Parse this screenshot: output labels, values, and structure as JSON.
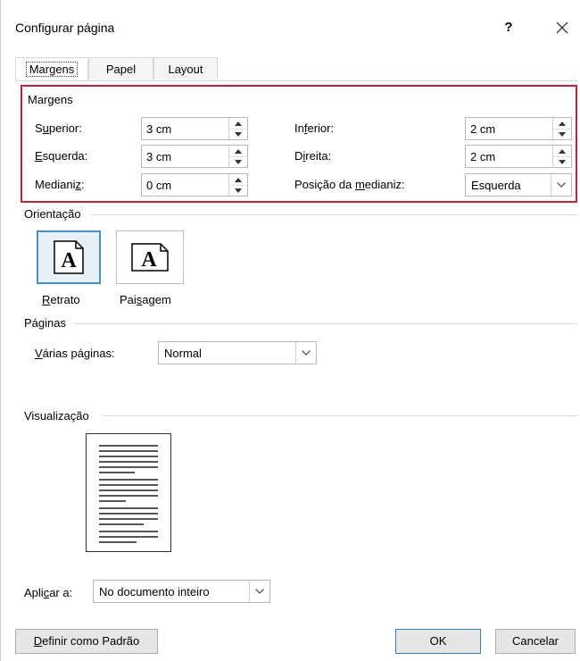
{
  "window": {
    "title": "Configurar página",
    "help": "?",
    "close_icon": "close-icon"
  },
  "tabs": [
    {
      "label": "Margens",
      "active": true
    },
    {
      "label": "Papel",
      "active": false
    },
    {
      "label": "Layout",
      "active": false
    }
  ],
  "margins": {
    "section_label": "Margens",
    "superior": {
      "label_pre": "S",
      "label_ul": "u",
      "label_post": "perior:",
      "value": "3 cm"
    },
    "inferior": {
      "label_pre": "In",
      "label_ul": "f",
      "label_post": "erior:",
      "value": "2 cm"
    },
    "esquerda": {
      "label_pre": "",
      "label_ul": "E",
      "label_post": "squerda:",
      "value": "3 cm"
    },
    "direita": {
      "label_pre": "D",
      "label_ul": "i",
      "label_post": "reita:",
      "value": "2 cm"
    },
    "medianiz": {
      "label_pre": "Mediani",
      "label_ul": "z",
      "label_post": ":",
      "value": "0 cm"
    },
    "posicao": {
      "label_pre": "Posição da ",
      "label_ul": "m",
      "label_post": "edianiz:",
      "value": "Esquerda"
    }
  },
  "orientation": {
    "section_label": "Orientação",
    "retrato": {
      "label_pre": "",
      "label_ul": "R",
      "label_post": "etrato",
      "selected": true
    },
    "paisagem": {
      "label_pre": "Pai",
      "label_ul": "s",
      "label_post": "agem",
      "selected": false
    },
    "glyph": "A"
  },
  "pages": {
    "section_label": "Páginas",
    "label_pre": "",
    "label_ul": "V",
    "label_post": "árias páginas:",
    "value": "Normal"
  },
  "preview": {
    "section_label": "Visualização"
  },
  "apply": {
    "label_pre": "Apli",
    "label_ul": "c",
    "label_post": "ar a:",
    "value": "No documento inteiro"
  },
  "buttons": {
    "default": {
      "label_pre": "",
      "label_ul": "D",
      "label_post": "efinir como Padrão"
    },
    "ok": "OK",
    "cancel": "Cancelar"
  },
  "colors": {
    "highlight_border": "#c0242f",
    "selected_border": "#4a90c8"
  }
}
